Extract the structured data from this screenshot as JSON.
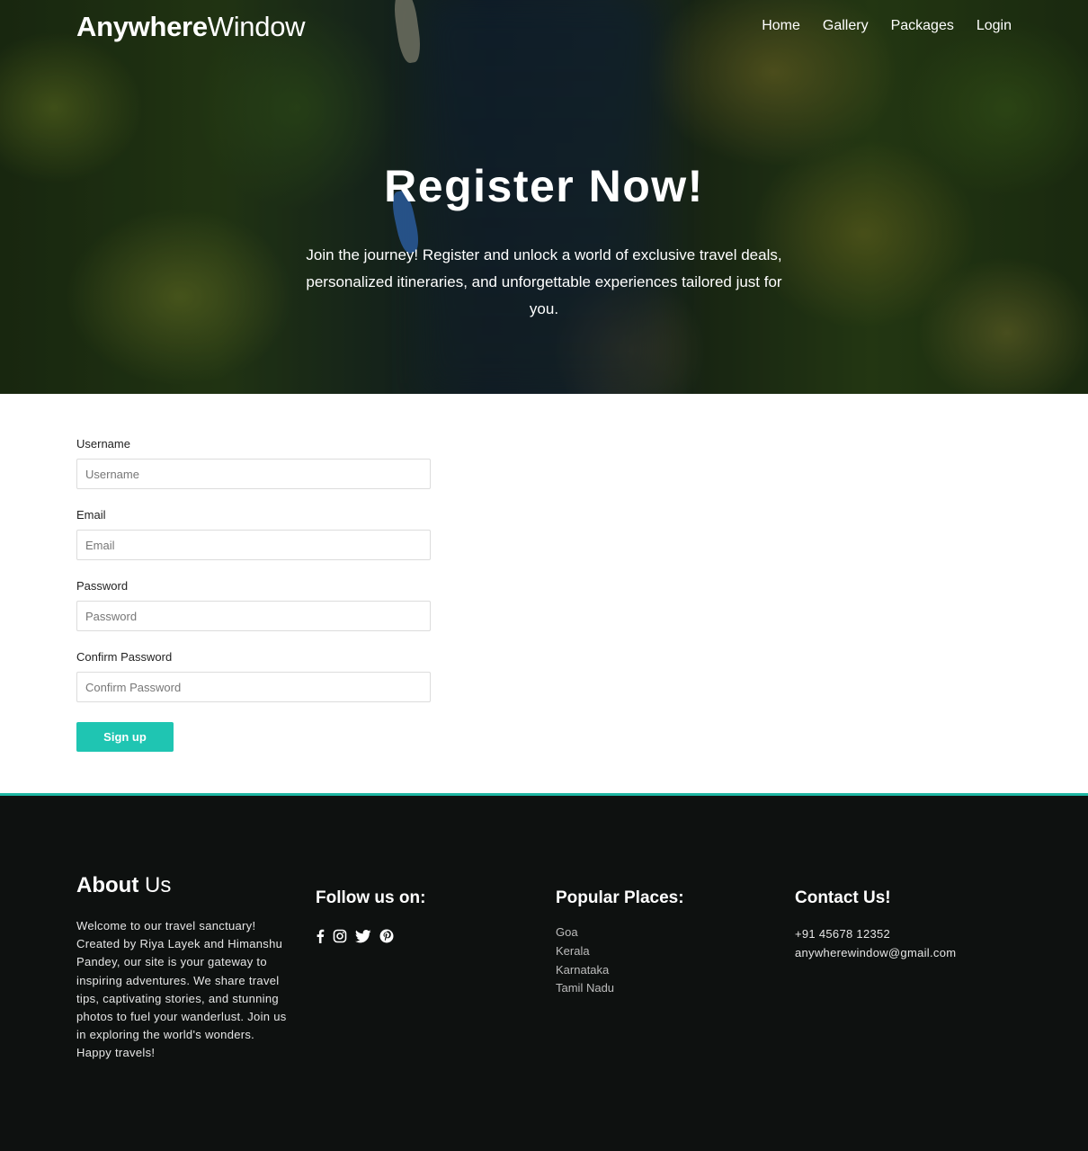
{
  "brand": {
    "bold": "Anywhere",
    "light": "Window"
  },
  "nav": {
    "items": [
      {
        "label": "Home"
      },
      {
        "label": "Gallery"
      },
      {
        "label": "Packages"
      },
      {
        "label": "Login"
      }
    ]
  },
  "hero": {
    "title": "Register Now!",
    "subtitle": "Join the journey! Register and unlock a world of exclusive travel deals, personalized itineraries, and unforgettable experiences tailored just for you."
  },
  "form": {
    "fields": [
      {
        "label": "Username",
        "placeholder": "Username",
        "value": ""
      },
      {
        "label": "Email",
        "placeholder": "Email",
        "value": ""
      },
      {
        "label": "Password",
        "placeholder": "Password",
        "value": ""
      },
      {
        "label": "Confirm Password",
        "placeholder": "Confirm Password",
        "value": ""
      }
    ],
    "submit_label": "Sign up"
  },
  "footer": {
    "about": {
      "title_bold": "About",
      "title_light": " Us",
      "text": "Welcome to our travel sanctuary! Created by Riya Layek and Himanshu Pandey, our site is your gateway to inspiring adventures. We share travel tips, captivating stories, and stunning photos to fuel your wanderlust. Join us in exploring the world's wonders. Happy travels!"
    },
    "follow": {
      "title": "Follow us on:",
      "icons": [
        "facebook-icon",
        "instagram-icon",
        "twitter-icon",
        "pinterest-icon"
      ]
    },
    "places": {
      "title": "Popular Places:",
      "items": [
        "Goa",
        "Kerala",
        "Karnataka",
        "Tamil Nadu"
      ]
    },
    "contact": {
      "title": "Contact Us!",
      "phone": "+91 45678 12352",
      "email": "anywherewindow@gmail.com"
    }
  },
  "colors": {
    "accent": "#1fc5b2",
    "footer_bg": "#0e1110",
    "footer_border": "#1fb7a4"
  }
}
